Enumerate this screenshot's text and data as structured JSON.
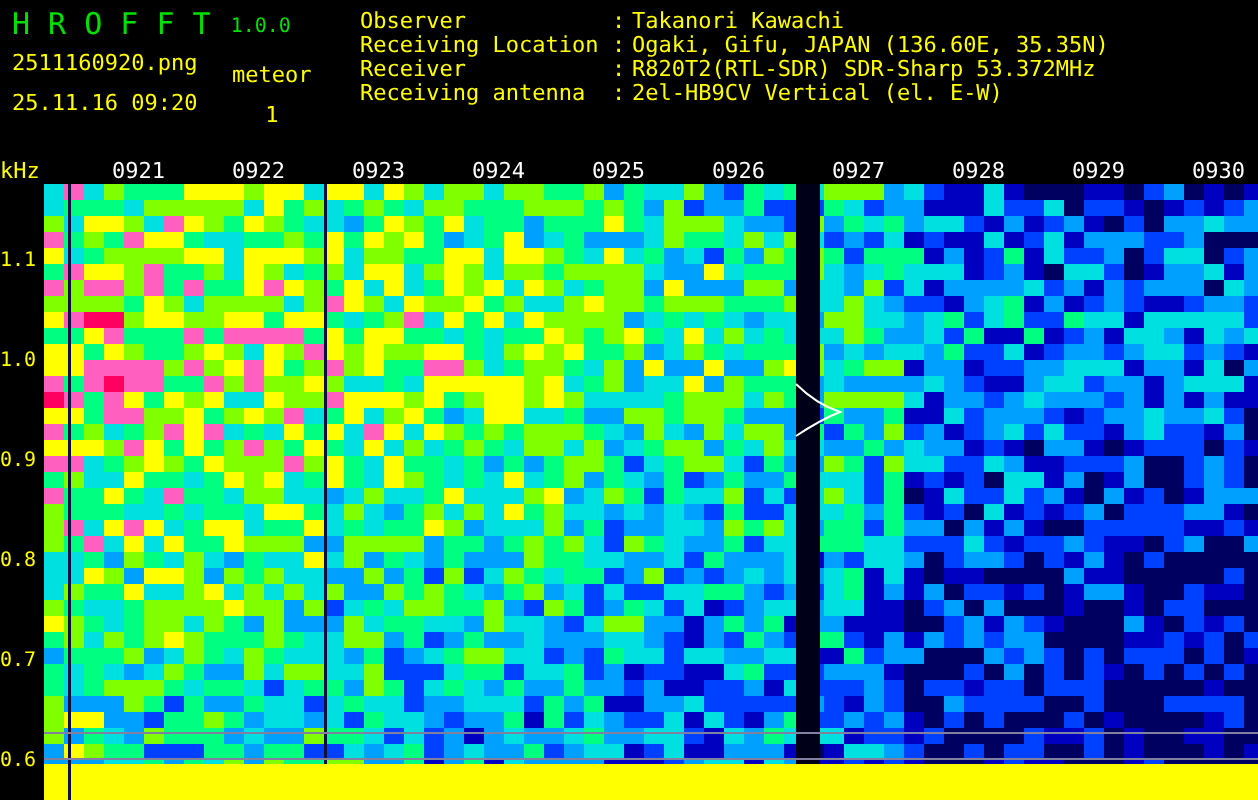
{
  "app": {
    "name": "H R O F F T",
    "version": "1.0.0",
    "file_name": "2511160920.png",
    "timestamp": "25.11.16 09:20",
    "count_label": "meteor",
    "count": "1"
  },
  "station_info": [
    {
      "label": "Observer",
      "colon": ":",
      "value": "Takanori Kawachi"
    },
    {
      "label": "Receiving Location",
      "colon": ":",
      "value": "Ogaki, Gifu, JAPAN (136.60E, 35.35N)"
    },
    {
      "label": "Receiver",
      "colon": ":",
      "value": "R820T2(RTL-SDR) SDR-Sharp 53.372MHz"
    },
    {
      "label": "Receiving antenna",
      "colon": ":",
      "value": "2el-HB9CV Vertical (el. E-W)"
    }
  ],
  "spectrogram": {
    "unit": "kHz",
    "frequency_ticks": [
      "1.1",
      "1.0",
      "0.9",
      "0.8",
      "0.7",
      "0.6"
    ],
    "time_labels": [
      "0921",
      "0922",
      "0923",
      "0924",
      "0925",
      "0926",
      "0927",
      "0928",
      "0929",
      "0930"
    ]
  }
}
